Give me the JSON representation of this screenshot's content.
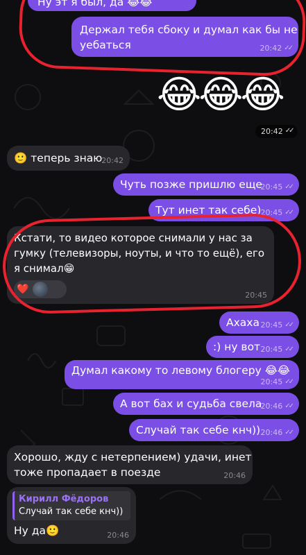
{
  "messages": {
    "m0": {
      "text": "Ну эт я был, да 😂😂"
    },
    "m1": {
      "line1": "Держал тебя сбоку и думал как бы не",
      "line2": "уебаться",
      "time": "20:42"
    },
    "m2": {
      "emoji": "😂😂😂",
      "time": "20:42"
    },
    "m3": {
      "emoji": "🙂",
      "text": "теперь знаю",
      "time": "20:42"
    },
    "m4": {
      "text": "Чуть позже пришлю еще",
      "time": "20:45"
    },
    "m5": {
      "text": "Тут инет так себе)",
      "time": "20:45"
    },
    "m6": {
      "line1": "Кстати, то видео которое снимали у нас за",
      "line2": "гумку (телевизоры, ноуты, и что то ещё), его",
      "line3": "я снимал😁",
      "reaction": "❤️",
      "time": "20:45"
    },
    "m7": {
      "text": "Ахаха",
      "time": "20:45"
    },
    "m8": {
      "text": ":) ну вот",
      "time": "20:45"
    },
    "m9": {
      "text": "Думал какому то левому блогеру 😂😂",
      "time": "20:45"
    },
    "m10": {
      "text": "А вот бах и судьба свела",
      "time": "20:46"
    },
    "m11": {
      "text": "Случай так себе кнч))",
      "time": "20:46"
    },
    "m12": {
      "line1": "Хорошо, жду с нетерпением) удачи, инет",
      "line2": "тоже пропадает в поезде",
      "time": "20:46"
    },
    "m13": {
      "reply_author": "Кирилл Фёдоров",
      "reply_text": "Случай так себе кнч))",
      "text": "Ну да🙂",
      "time": "20:46"
    }
  },
  "colors": {
    "outgoing_bubble": "#7b4ee6",
    "incoming_bubble": "#27272c",
    "annotation": "#e8232f",
    "reply_author": "#9a72f5"
  }
}
